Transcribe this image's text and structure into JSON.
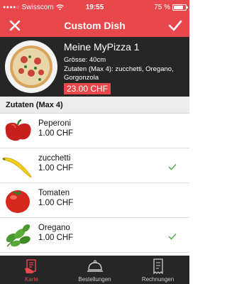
{
  "status": {
    "carrier": "Swisscom",
    "time": "19:55",
    "battery": "75 %"
  },
  "nav": {
    "title": "Custom Dish"
  },
  "dish": {
    "name": "Meine MyPizza 1",
    "size": "Grösse:  40cm",
    "description": "Zutaten (Max 4): zucchetti, Oregano, Gorgonzola",
    "price": "23.00 CHF"
  },
  "section_title": "Zutaten (Max 4)",
  "ingredients": [
    {
      "name": "Peperoni",
      "price": "1.00 CHF",
      "selected": false,
      "icon": "pepper-image"
    },
    {
      "name": "zucchetti",
      "price": "1.00 CHF",
      "selected": true,
      "icon": "zucchini-image"
    },
    {
      "name": "Tomaten",
      "price": "1.00 CHF",
      "selected": false,
      "icon": "tomato-image"
    },
    {
      "name": "Oregano",
      "price": "1.00 CHF",
      "selected": true,
      "icon": "oregano-image"
    }
  ],
  "tabs": [
    {
      "label": "Karte",
      "icon": "menu-card-icon",
      "active": true
    },
    {
      "label": "Bestellungen",
      "icon": "cloche-icon",
      "active": false
    },
    {
      "label": "Rechnungen",
      "icon": "receipt-icon",
      "active": false
    }
  ],
  "colors": {
    "accent": "#e8474c",
    "dark": "#262626",
    "check": "#4caf50"
  }
}
